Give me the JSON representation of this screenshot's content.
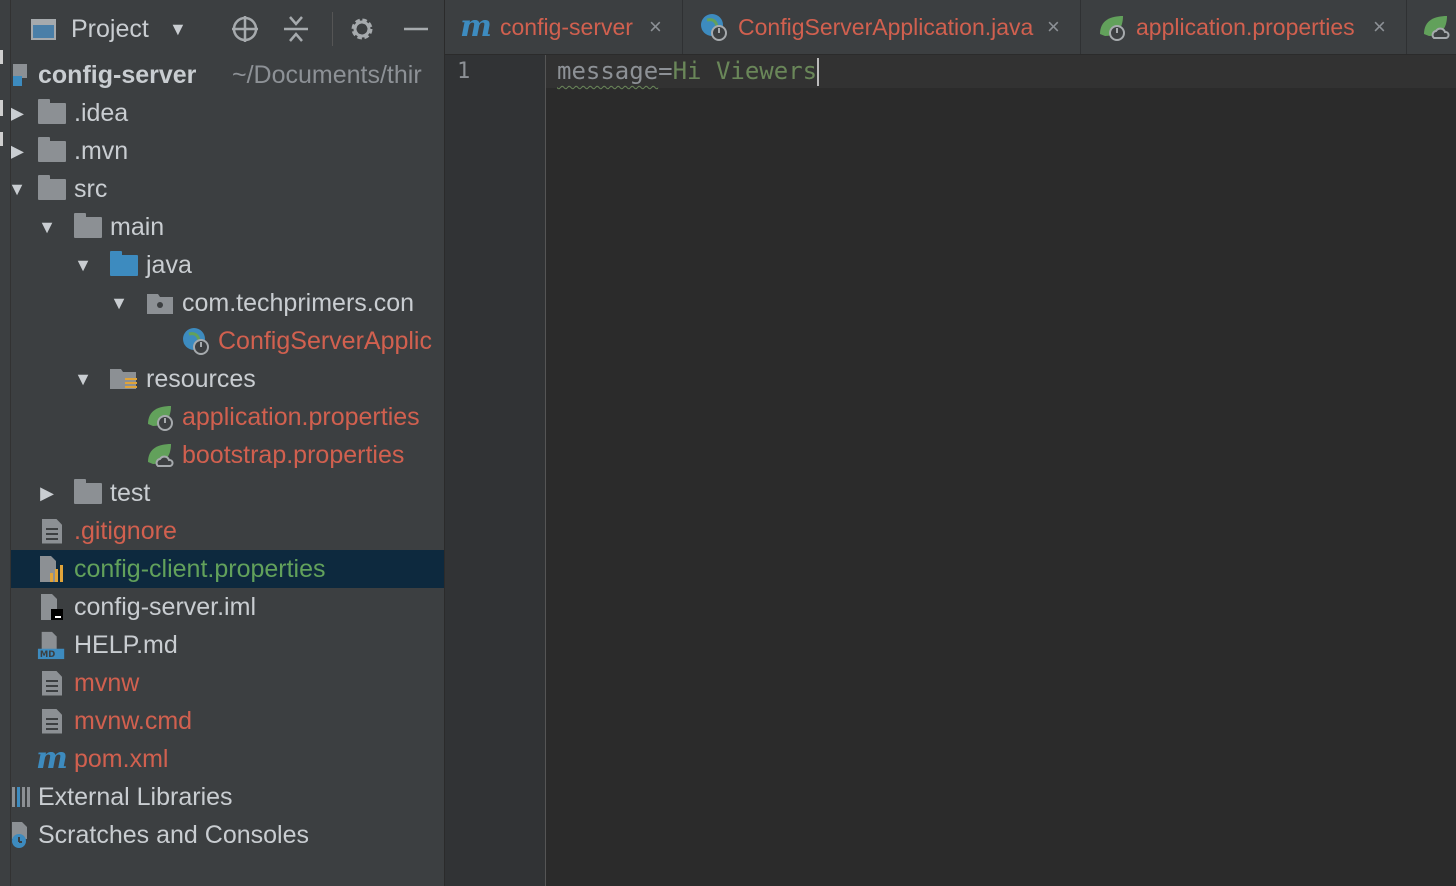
{
  "project_panel": {
    "title": "Project",
    "dropdown_arrow": "▼"
  },
  "tree": {
    "root_name": "config-server",
    "root_path": "~/Documents/thir",
    "items": [
      {
        "label": ".idea"
      },
      {
        "label": ".mvn"
      },
      {
        "label": "src"
      },
      {
        "label": "main"
      },
      {
        "label": "java"
      },
      {
        "label": "com.techprimers.con"
      },
      {
        "label": "ConfigServerApplic"
      },
      {
        "label": "resources"
      },
      {
        "label": "application.properties"
      },
      {
        "label": "bootstrap.properties"
      },
      {
        "label": "test"
      },
      {
        "label": ".gitignore"
      },
      {
        "label": "config-client.properties"
      },
      {
        "label": "config-server.iml"
      },
      {
        "label": "HELP.md"
      },
      {
        "label": "mvnw"
      },
      {
        "label": "mvnw.cmd"
      },
      {
        "label": "pom.xml"
      },
      {
        "label": "External Libraries"
      },
      {
        "label": "Scratches and Consoles"
      }
    ]
  },
  "tabs": [
    {
      "label": "config-server",
      "close": "×"
    },
    {
      "label": "ConfigServerApplication.java",
      "close": "×"
    },
    {
      "label": "application.properties",
      "close": "×"
    }
  ],
  "editor": {
    "line_number": "1",
    "key": "message",
    "equals": "=",
    "value": "Hi Viewers"
  },
  "colors": {
    "panel_bg": "#3c3f41",
    "editor_bg": "#2b2b2b",
    "selected_row": "#0d293e",
    "modified_red": "#d1604f",
    "added_green": "#62a15b",
    "string_green": "#6a8759"
  }
}
